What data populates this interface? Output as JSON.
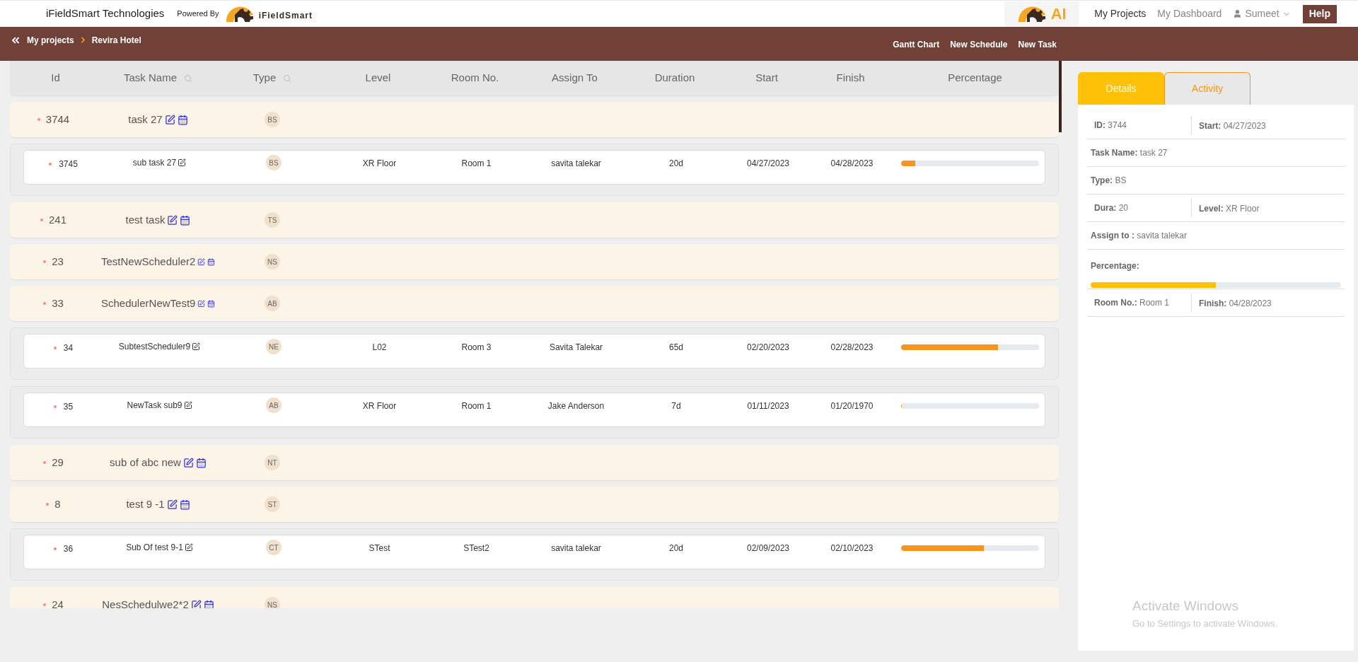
{
  "header": {
    "company": "iFieldSmart Technologies",
    "powered_by": "Powered By",
    "logo_text": "iFieldSmart",
    "ai_logo_text": "AI",
    "nav": [
      {
        "label": "My Projects",
        "selected": true
      },
      {
        "label": "My Dashboard",
        "selected": false
      }
    ],
    "user": "Sumeet",
    "help": "Help"
  },
  "toolbar": {
    "breadcrumb": [
      "My projects",
      "Revira Hotel"
    ],
    "actions": [
      "Gantt Chart",
      "New Schedule",
      "New Task"
    ]
  },
  "table": {
    "columns": [
      {
        "label": "Id",
        "searchable": false
      },
      {
        "label": "Task Name",
        "searchable": true
      },
      {
        "label": "Type",
        "searchable": true
      },
      {
        "label": "Level",
        "searchable": false
      },
      {
        "label": "Room No.",
        "searchable": false
      },
      {
        "label": "Assign To",
        "searchable": false
      },
      {
        "label": "Duration",
        "searchable": false
      },
      {
        "label": "Start",
        "searchable": false
      },
      {
        "label": "Finish",
        "searchable": false
      },
      {
        "label": "Percentage",
        "searchable": false
      }
    ],
    "rows": [
      {
        "kind": "task",
        "id": "3744",
        "name": "task 27",
        "type": "BS"
      },
      {
        "kind": "subtask",
        "id": "3745",
        "name": "sub task 27",
        "type": "BS",
        "level_name": "XR Floor",
        "room": "Room 1",
        "assign_to": "savita talekar",
        "duration": "20d",
        "start": "04/27/2023",
        "finish": "04/28/2023",
        "level": 0.1
      },
      {
        "kind": "task",
        "id": "241",
        "name": "test task",
        "type": "TS"
      },
      {
        "kind": "task",
        "id": "23",
        "name": "TestNewScheduler2",
        "type": "NS"
      },
      {
        "kind": "task",
        "id": "33",
        "name": "SchedulerNewTest9",
        "type": "AB"
      },
      {
        "kind": "subtask",
        "id": "34",
        "name": "SubtestScheduler9",
        "type": "NE",
        "level_name": "L02",
        "room": "Room 3",
        "assign_to": "Savita Talekar",
        "duration": "65d",
        "start": "02/20/2023",
        "finish": "02/28/2023",
        "level": 0.7
      },
      {
        "kind": "subtask",
        "id": "35",
        "name": "NewTask sub9",
        "type": "AB",
        "level_name": "XR Floor",
        "room": "Room 1",
        "assign_to": "Jake Anderson",
        "duration": "7d",
        "start": "01/11/2023",
        "finish": "01/20/1970",
        "level": 0
      },
      {
        "kind": "task",
        "id": "29",
        "name": "sub of abc new",
        "type": "NT"
      },
      {
        "kind": "task",
        "id": "8",
        "name": "test 9 -1",
        "type": "ST"
      },
      {
        "kind": "subtask",
        "id": "36",
        "name": "Sub Of test 9-1",
        "type": "CT",
        "level_name": "STest",
        "room": "STest2",
        "assign_to": "savita talekar",
        "duration": "20d",
        "start": "02/09/2023",
        "finish": "02/10/2023",
        "level": 0.6
      },
      {
        "kind": "task",
        "id": "24",
        "name": "NesSchedulwe2*2",
        "type": "NS"
      }
    ]
  },
  "details": {
    "tabs": [
      {
        "label": "Details",
        "selected": true
      },
      {
        "label": "Activity",
        "selected": false
      }
    ],
    "fields": [
      {
        "kind": "pair",
        "items": [
          {
            "label": "ID:",
            "value": "3744"
          },
          {
            "label": "Start:",
            "value": "04/27/2023"
          }
        ]
      },
      {
        "kind": "single",
        "label": "Task Name:",
        "value": "task 27"
      },
      {
        "kind": "single",
        "label": "Type:",
        "value": "BS"
      },
      {
        "kind": "pair",
        "items": [
          {
            "label": "Dura:",
            "value": "20"
          },
          {
            "label": "Level:",
            "value": "XR Floor"
          }
        ]
      },
      {
        "kind": "single",
        "label": "Assign to :",
        "value": "savita talekar"
      },
      {
        "kind": "progress",
        "label": "Percentage:",
        "level": 0.5
      },
      {
        "kind": "pair",
        "items": [
          {
            "label": "Room No.:",
            "value": "Room 1"
          },
          {
            "label": "Finish:",
            "value": "04/28/2023"
          }
        ]
      }
    ]
  },
  "os_notice": {
    "title": "Activate Windows",
    "text": "Go to Settings to activate Windows."
  }
}
